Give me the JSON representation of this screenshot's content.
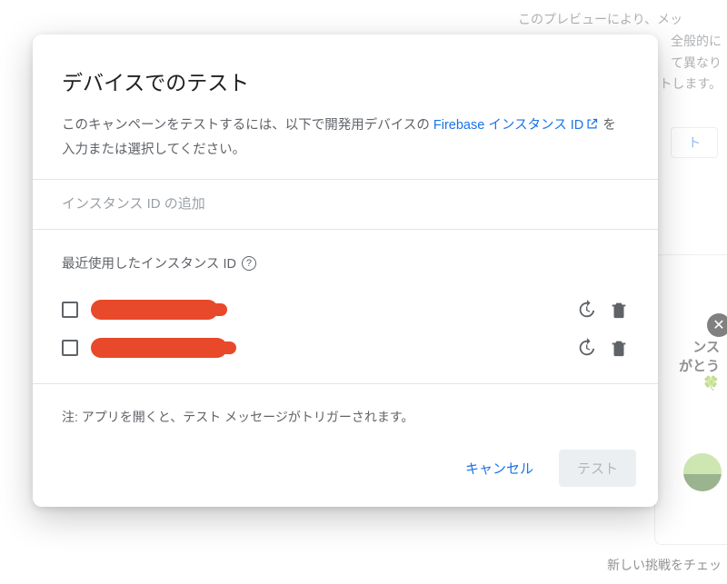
{
  "background": {
    "text1": "このプレビューにより、メッ",
    "text2": "全般的に",
    "text3": "て異なり",
    "text4": "トします。",
    "btn": "ト",
    "card_line1": "ンス",
    "card_line2": "がとう",
    "card_emoji": "🍀",
    "bottom": "新しい挑戦をチェッ"
  },
  "modal": {
    "title": "デバイスでのテスト",
    "desc_before": "このキャンペーンをテストするには、以下で開発用デバイスの ",
    "link_text": "Firebase インスタンス ID",
    "desc_after": " を入力または選択してください。",
    "input_placeholder": "インスタンス ID の追加",
    "recent_label": "最近使用したインスタンス ID",
    "rows": [
      {
        "id_redacted": true
      },
      {
        "id_redacted": true
      }
    ],
    "note": "注: アプリを開くと、テスト メッセージがトリガーされます。",
    "cancel": "キャンセル",
    "test": "テスト"
  }
}
